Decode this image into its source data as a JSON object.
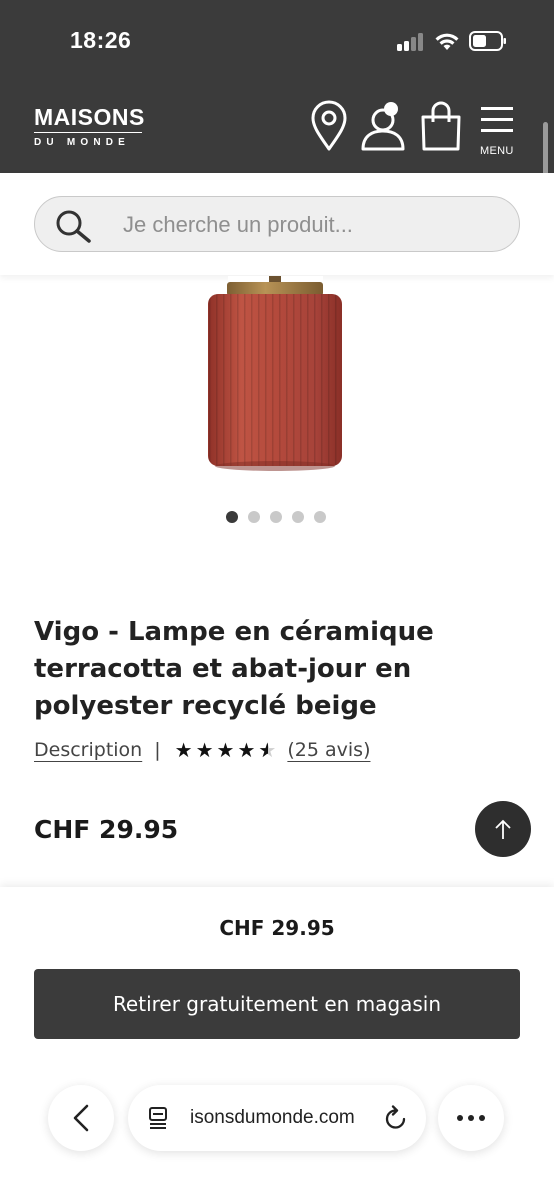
{
  "status_bar": {
    "time": "18:26"
  },
  "header": {
    "logo_main": "MAISONS",
    "logo_sub": "DU MONDE",
    "menu_label": "MENU"
  },
  "search": {
    "placeholder": "Je cherche un produit..."
  },
  "carousel": {
    "total_slides": 5,
    "active_slide": 1
  },
  "product": {
    "title": "Vigo - Lampe en céramique terracotta et abat-jour en polyester recyclé beige",
    "description_link": "Description",
    "separator": "|",
    "rating": 4.5,
    "rating_max": 5,
    "reviews_link": "(25 avis)",
    "price": "CHF 29.95"
  },
  "sticky_bar": {
    "price": "CHF 29.95",
    "cta_label": "Retirer gratuitement en magasin"
  },
  "browser": {
    "url": "isonsdumonde.com"
  },
  "colors": {
    "header_bg": "#3b3b3b",
    "lamp_terracotta": "#b2493b",
    "lamp_lid_gold": "#a07d45",
    "cta_bg": "#3b3b3b"
  }
}
